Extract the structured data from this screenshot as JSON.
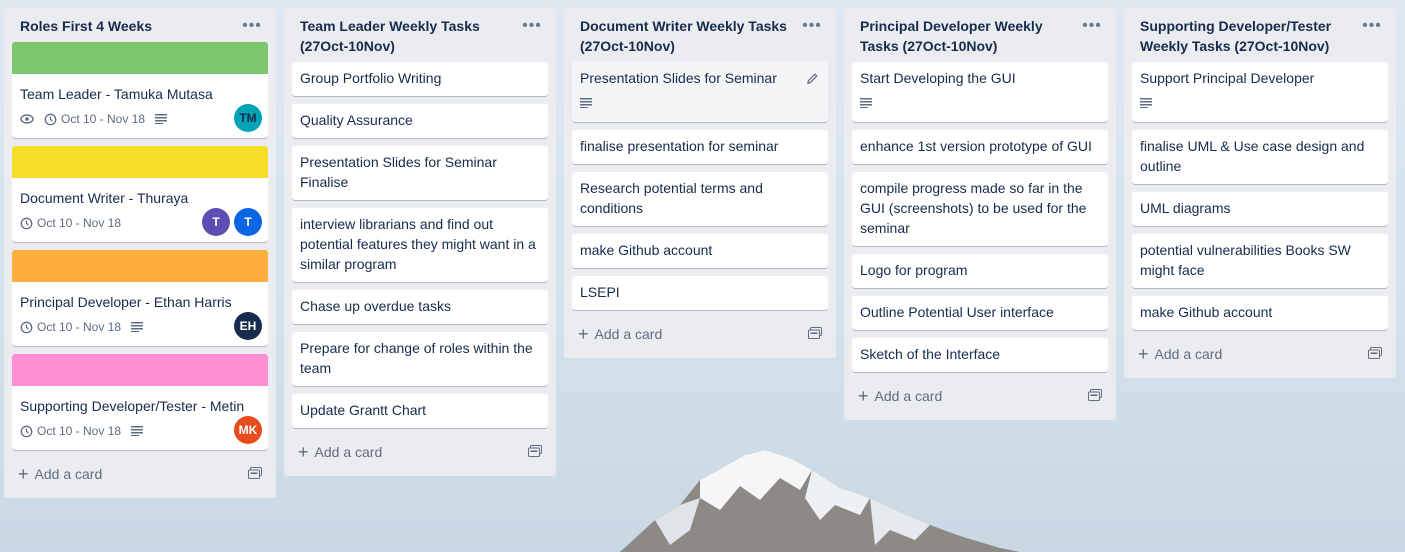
{
  "colors": {
    "label_green": "#7bc86c",
    "label_yellow": "#f5dd29",
    "label_orange": "#ffaf3f",
    "label_pink": "#ff8ed4",
    "avatar_teal": "#00a2b5",
    "avatar_purple": "#5e4db2",
    "avatar_blue": "#0c66e4",
    "avatar_navy": "#172b4d",
    "avatar_red": "#e84c1e"
  },
  "add_card_label": "Add a card",
  "lists": [
    {
      "title": "Roles First 4 Weeks",
      "cards": [
        {
          "title": "Team Leader - Tamuka Mutasa",
          "dates": "Oct 10 - Nov 18",
          "members": [
            "TM"
          ]
        },
        {
          "title": "Document Writer - Thuraya",
          "dates": "Oct 10 - Nov 18",
          "members": [
            "T",
            "T"
          ]
        },
        {
          "title": "Principal Developer - Ethan Harris",
          "dates": "Oct 10 - Nov 18",
          "members": [
            "EH"
          ]
        },
        {
          "title": "Supporting Developer/Tester - Metin",
          "dates": "Oct 10 - Nov 18",
          "members": [
            "MK"
          ]
        }
      ]
    },
    {
      "title": "Team Leader Weekly Tasks (27Oct-10Nov)",
      "cards": [
        "Group Portfolio Writing",
        "Quality Assurance",
        "Presentation Slides for Seminar Finalise",
        "interview librarians and find out potential features they might want in a similar program",
        "Chase up overdue tasks",
        "Prepare for change of roles within the team",
        "Update Grantt Chart"
      ]
    },
    {
      "title": "Document Writer Weekly Tasks (27Oct-10Nov)",
      "cards": [
        "Presentation Slides for Seminar",
        "finalise presentation for seminar",
        "Research potential terms and conditions",
        "make Github account",
        "LSEPI"
      ]
    },
    {
      "title": "Principal Developer Weekly Tasks (27Oct-10Nov)",
      "cards": [
        "Start Developing the GUI",
        "enhance 1st version prototype of GUI",
        "compile progress made so far in the GUI (screenshots) to be used for the seminar",
        "Logo for program",
        "Outline Potential User interface",
        "Sketch of the Interface"
      ]
    },
    {
      "title": "Supporting Developer/Tester Weekly Tasks (27Oct-10Nov)",
      "cards": [
        "Support Principal Developer",
        "finalise UML & Use case design and outline",
        "UML diagrams",
        "potential vulnerabilities Books SW might face",
        "make Github account"
      ]
    }
  ]
}
